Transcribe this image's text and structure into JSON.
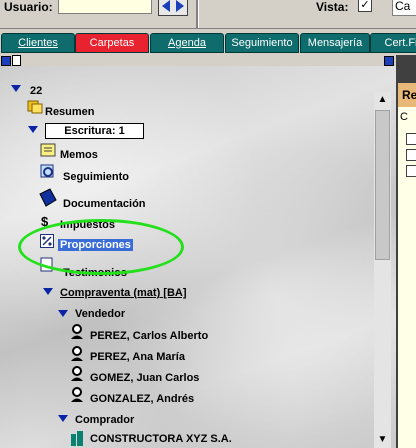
{
  "header": {
    "usuario_label": "Usuario:",
    "usuario_value": "",
    "vista_label": "Vista:",
    "vista_checked": "✓",
    "right_field_value": "Ca"
  },
  "tabs": [
    {
      "label": "Clientes",
      "active": false
    },
    {
      "label": "Carpetas",
      "active": true
    },
    {
      "label": "Agenda",
      "active": false
    },
    {
      "label": "Seguimiento",
      "active": false
    },
    {
      "label": "Mensajería",
      "active": false
    },
    {
      "label": "Cert.Fi",
      "active": false
    }
  ],
  "tree": {
    "root": "22",
    "resumen": "Resumen",
    "escritura": "Escritura: 1",
    "memos": "Memos",
    "seguimiento": "Seguimiento",
    "documentacion": "Documentación",
    "impuestos": "Impuestos",
    "proporciones": "Proporciones",
    "testimonios": "Testimonios",
    "compraventa": "Compraventa (mat) [BA]",
    "vendedor": "Vendedor",
    "vendedores": [
      "PEREZ, Carlos Alberto",
      "PEREZ, Ana María",
      "GOMEZ, Juan Carlos",
      "GONZALEZ, Andrés"
    ],
    "comprador": "Comprador",
    "compradores": [
      "CONSTRUCTORA XYZ S.A."
    ]
  },
  "right_panel": {
    "header": "Re",
    "column": "C"
  },
  "colors": {
    "tab": "#0e6c6c",
    "tab_active": "#e8222e",
    "selection": "#3a6cd8",
    "highlight_circle": "#22e01a",
    "tree_arrow": "#0a24a8"
  }
}
